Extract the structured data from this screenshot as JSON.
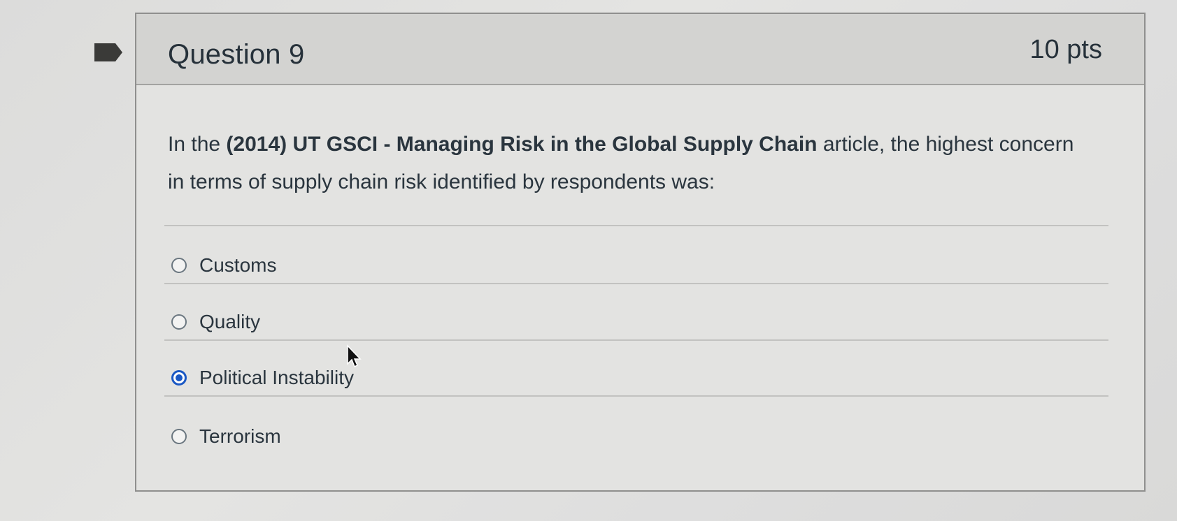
{
  "question": {
    "title": "Question 9",
    "points": "10 pts",
    "text_prefix": "In the ",
    "text_bold": "(2014) UT GSCI - Managing Risk in the Global Supply Chain",
    "text_suffix": " article, the highest concern in terms of supply chain risk identified by respondents was:"
  },
  "answers": [
    {
      "label": "Customs",
      "selected": false
    },
    {
      "label": "Quality",
      "selected": false
    },
    {
      "label": "Political Instability",
      "selected": true
    },
    {
      "label": "Terrorism",
      "selected": false
    }
  ],
  "colors": {
    "flag": "#3a3a38",
    "selected_radio": "#1a58c4",
    "header_bg": "#d3d3d1"
  },
  "icons": {
    "flag": "bookmark-flag-icon",
    "cursor": "mouse-pointer-icon"
  }
}
